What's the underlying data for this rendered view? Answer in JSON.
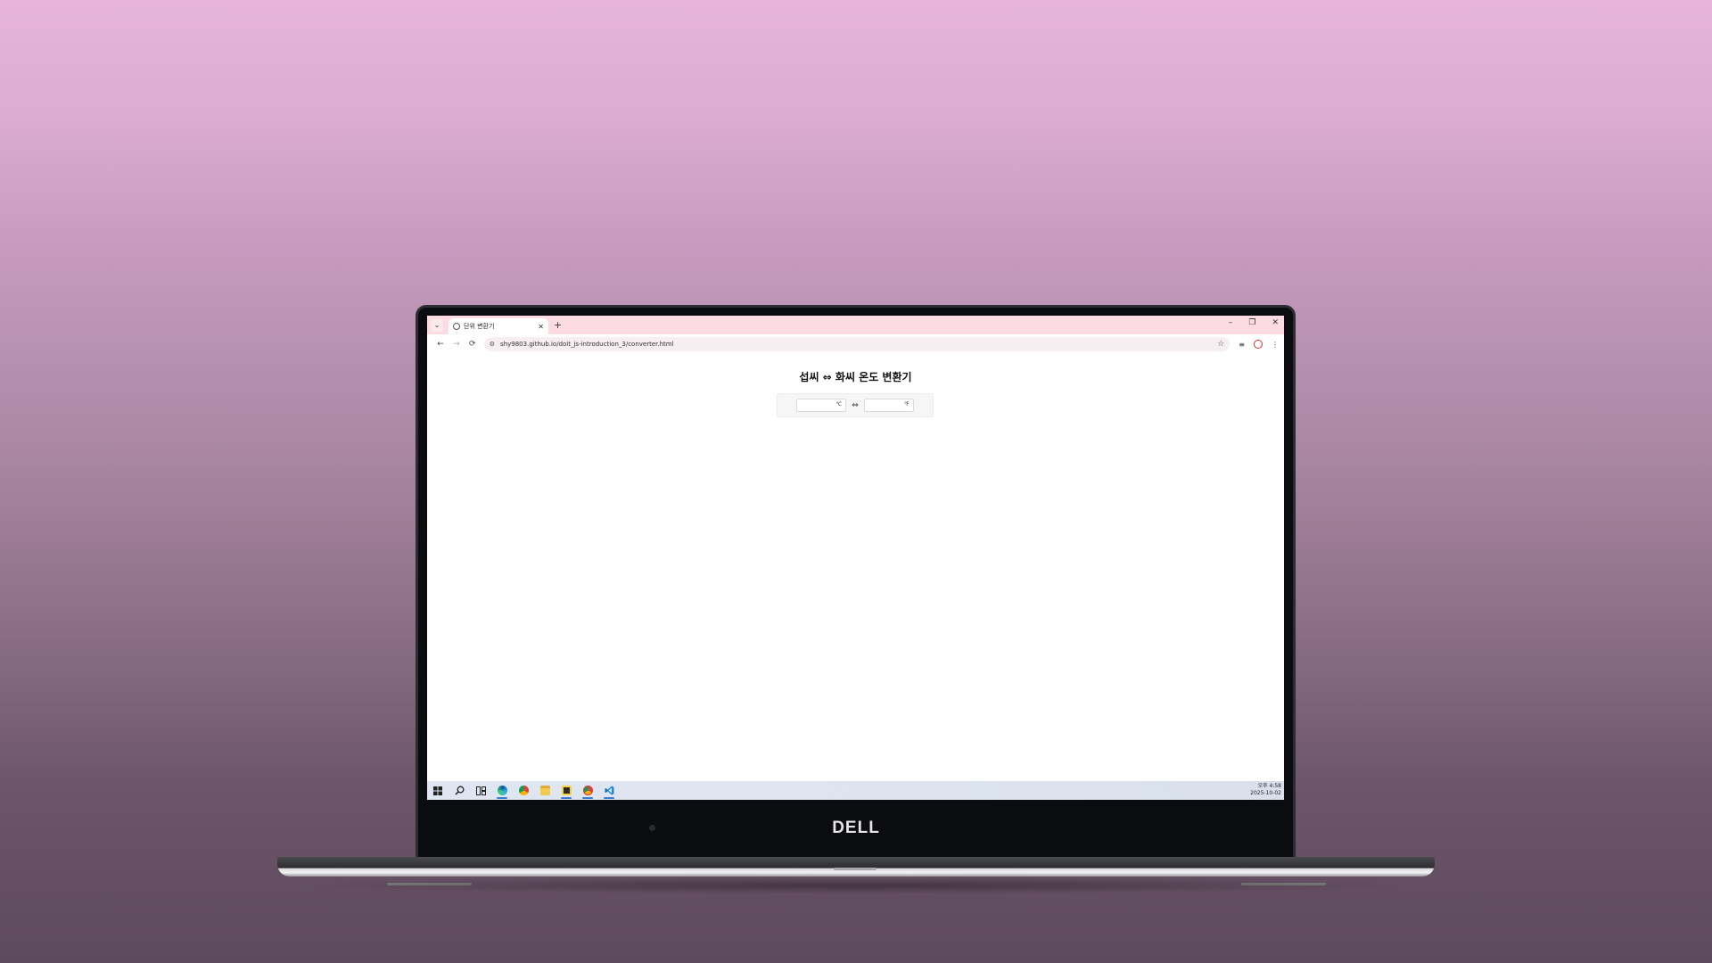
{
  "bezel": {
    "brand": "DELL"
  },
  "browser": {
    "tab_menu_icon": "chevron-down-icon",
    "tab_title": "단위 변환기",
    "tab_close": "✕",
    "new_tab": "+",
    "window_controls": {
      "minimize": "–",
      "restore": "❐",
      "close": "✕"
    },
    "nav": {
      "back": "←",
      "forward": "→",
      "reload": "⟳"
    },
    "url": "shy9803.github.io/doit_js-introduction_3/converter.html",
    "bookmark_icon": "star-icon"
  },
  "page": {
    "title": "섭씨 ⇔ 화씨 온도 변환기",
    "celsius": {
      "value": "",
      "unit": "℃"
    },
    "arrow": "⇔",
    "fahrenheit": {
      "value": "",
      "unit": "℉"
    }
  },
  "taskbar": {
    "icons": [
      "windows-start-icon",
      "search-icon",
      "task-view-icon",
      "edge-icon",
      "chrome-icon",
      "file-explorer-icon",
      "sticky-notes-icon",
      "chrome-profile-icon",
      "vscode-icon"
    ],
    "time": "오후 4:58",
    "date": "2025-10-02"
  },
  "colors": {
    "titlebar": "#fddbe2",
    "taskbar": "#dfe6f1",
    "chrome_accent": "#3a7bd5"
  }
}
